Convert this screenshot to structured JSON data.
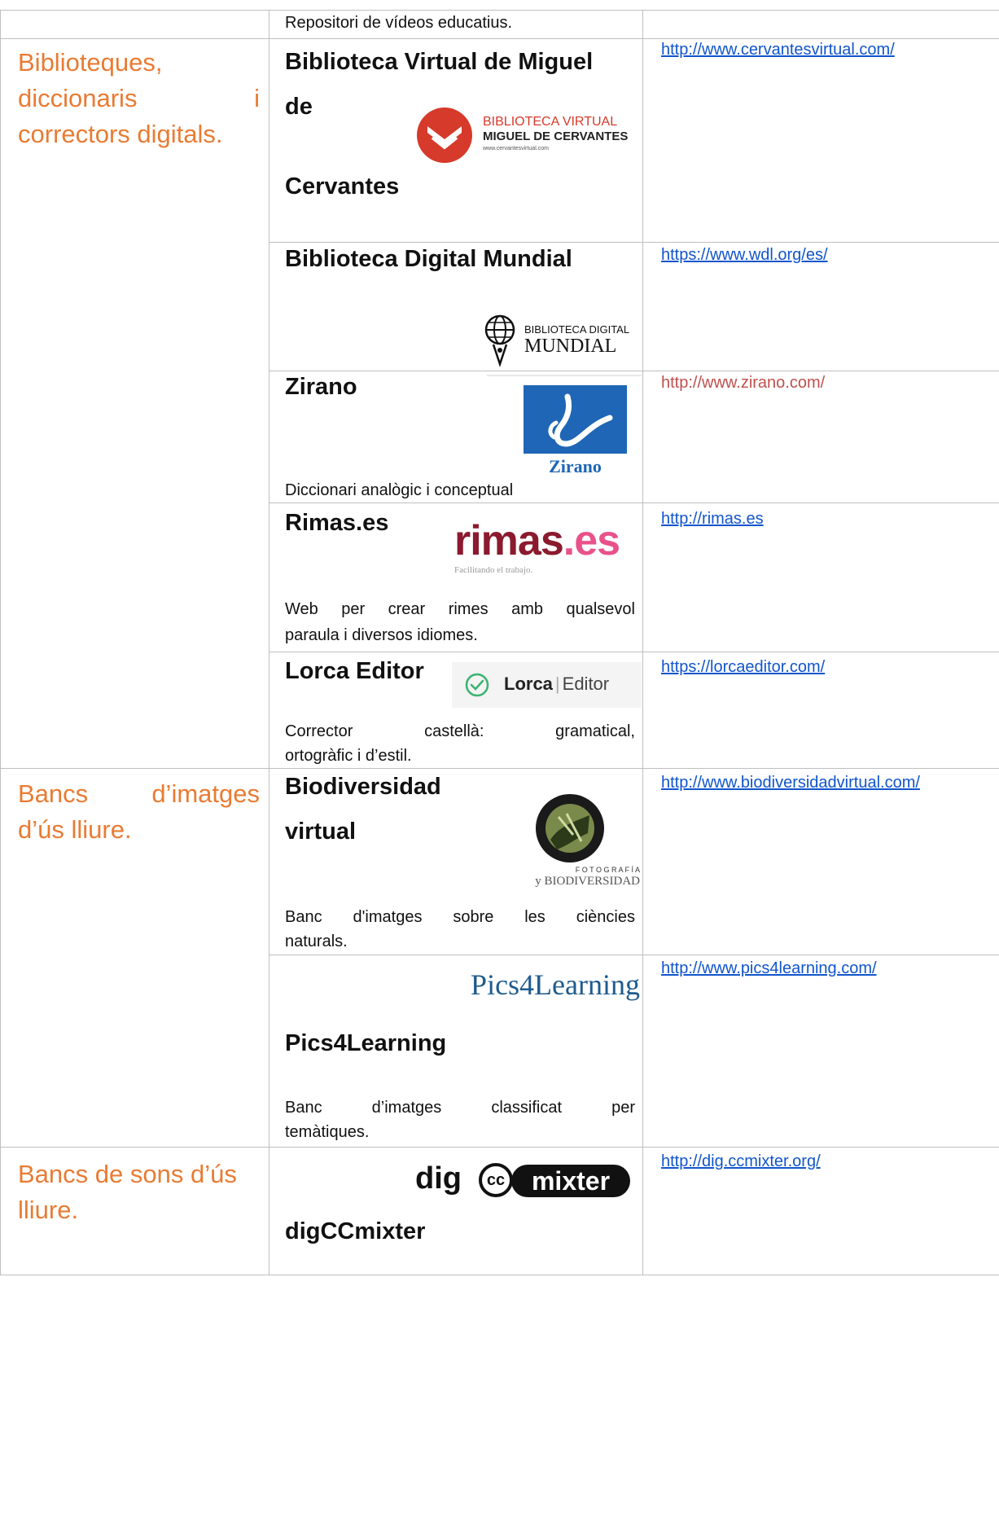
{
  "top_row": {
    "description": "Repositori de vídeos educatius."
  },
  "rows": {
    "cervantes": {
      "category_lines": [
        "Biblioteques,",
        "diccionaris",
        "i",
        "correctors digitals."
      ],
      "title_line1": "Biblioteca Virtual de Miguel",
      "title_line2": "de",
      "title_line3": "Cervantes",
      "logo_line1": "BIBLIOTECA VIRTUAL",
      "logo_line2": "MIGUEL DE CERVANTES",
      "logo_line3": "www.cervantesvirtual.com",
      "url": "http://www.cervantesvirtual.com/"
    },
    "wdl": {
      "title": "Biblioteca Digital Mundial",
      "logo_line1": "BIBLIOTECA DIGITAL",
      "logo_line2": "MUNDIAL",
      "url": "https://www.wdl.org/es/"
    },
    "zirano": {
      "title": "Zirano",
      "logo_text": "Zirano",
      "description": "Diccionari analògic i conceptual",
      "url": "http://www.zirano.com/"
    },
    "rimas": {
      "title": "Rimas.es",
      "logo_main": "rimas",
      "logo_suffix": ".es",
      "logo_tagline": "Facilitando el trabajo.",
      "description_line1": [
        "Web",
        "per",
        "crear",
        "rimes",
        "amb",
        "qualsevol"
      ],
      "description_line2": "paraula i diversos idiomes.",
      "url": "http://rimas.es"
    },
    "lorca": {
      "title": "Lorca Editor",
      "logo_left": "Lorca",
      "logo_right": "Editor",
      "description_line1": [
        "Corrector",
        "castellà:",
        "gramatical,"
      ],
      "description_line2": "ortogràfic i d’estil.",
      "url": "https://lorcaeditor.com/"
    },
    "biodiversidad": {
      "category_lines": [
        "Bancs",
        "d’imatges",
        "d’ús lliure."
      ],
      "title_line1": "Biodiversidad",
      "title_line2": "virtual",
      "logo_line1": "F O T O G R A F Í A",
      "logo_line2": "y BIODIVERSIDAD",
      "description_line1": [
        "Banc",
        "d'imatges",
        "sobre",
        "les",
        "ciències"
      ],
      "description_line2": "naturals.",
      "url": "http://www.biodiversidadvirtual.com/"
    },
    "pics4learning": {
      "logo_text": "Pics4Learning",
      "title": "Pics4Learning",
      "description_line1": [
        "Banc",
        "d’imatges",
        "classificat",
        "per"
      ],
      "description_line2": "temàtiques.",
      "url": "http://www.pics4learning.com/"
    },
    "ccmixter": {
      "category_lines": [
        "Bancs de sons d’ús",
        "lliure."
      ],
      "logo_left": "dig",
      "logo_cc": "cc",
      "logo_right": "mixter",
      "title": "digCCmixter",
      "url": "http://dig.ccmixter.org/"
    }
  },
  "colors": {
    "category": "#e97b33",
    "link": "#1155cc",
    "plain_url": "#c0504d",
    "border": "#bfbfbf"
  }
}
